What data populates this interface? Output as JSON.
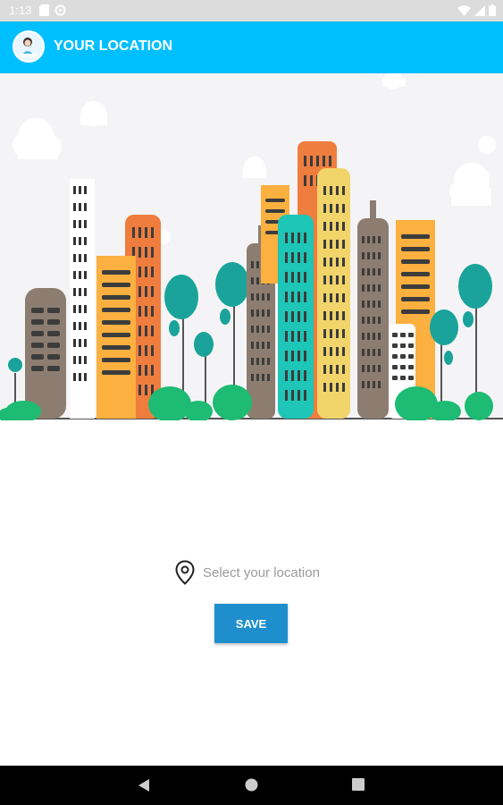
{
  "status_bar": {
    "time": "1:13",
    "icons": [
      "sd-card-icon",
      "sync-icon",
      "wifi-icon",
      "signal-icon",
      "battery-icon"
    ]
  },
  "app_bar": {
    "title": "YOUR LOCATION",
    "avatar": "avatar"
  },
  "hero": {
    "image": "city-skyline-illustration"
  },
  "location": {
    "icon": "location-pin-icon",
    "placeholder": "Select your location"
  },
  "actions": {
    "save_label": "SAVE"
  },
  "nav_bar": {
    "buttons": [
      "back-icon",
      "home-icon",
      "recents-icon"
    ]
  },
  "colors": {
    "app_bar": "#00bfff",
    "save_button": "#1e8fcc",
    "status_bar": "#dcdcdc",
    "nav_bar": "#000000"
  }
}
